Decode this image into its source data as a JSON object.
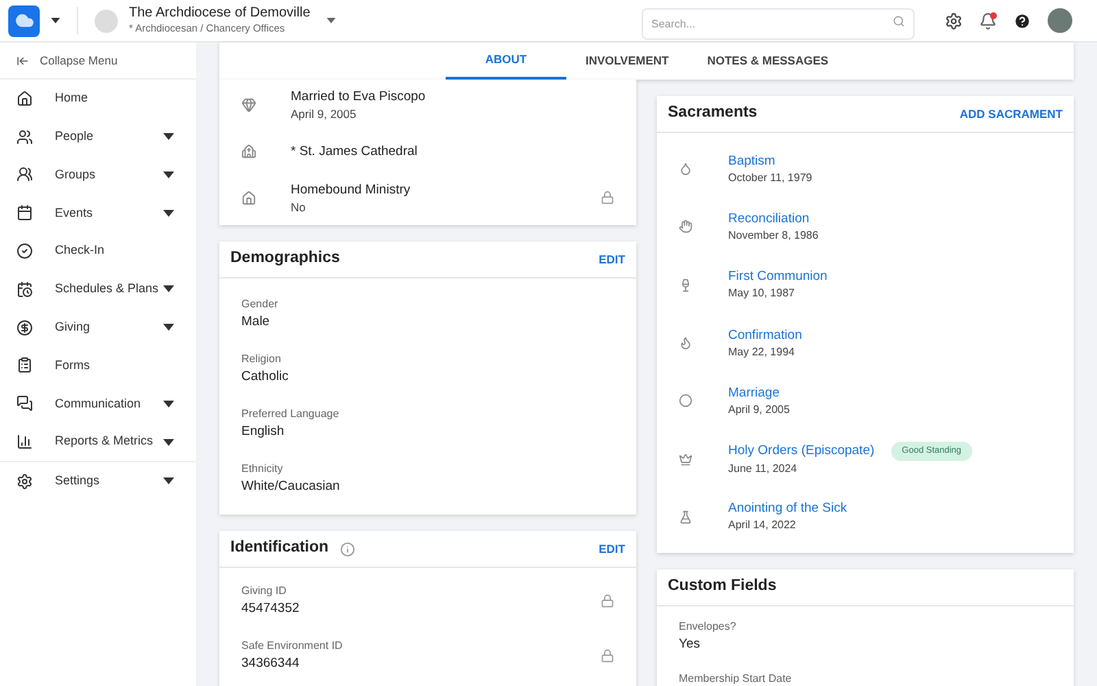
{
  "header": {
    "org_name": "The Archdiocese of Demoville",
    "org_subtitle": "* Archdiocesan / Chancery Offices",
    "search": {
      "placeholder": "Search..."
    },
    "has_notification": true
  },
  "sidebar": {
    "collapse_label": "Collapse Menu",
    "items": [
      {
        "label": "Home",
        "expandable": false
      },
      {
        "label": "People",
        "expandable": true
      },
      {
        "label": "Groups",
        "expandable": true
      },
      {
        "label": "Events",
        "expandable": true
      },
      {
        "label": "Check-In",
        "expandable": false
      },
      {
        "label": "Schedules & Plans",
        "expandable": true
      },
      {
        "label": "Giving",
        "expandable": true
      },
      {
        "label": "Forms",
        "expandable": false
      },
      {
        "label": "Communication",
        "expandable": true
      },
      {
        "label": "Reports & Metrics",
        "expandable": true
      }
    ],
    "footer_items": [
      {
        "label": "Settings",
        "expandable": true
      }
    ]
  },
  "tabs": [
    {
      "label": "ABOUT",
      "selected": true
    },
    {
      "label": "INVOLVEMENT",
      "selected": false
    },
    {
      "label": "NOTES & MESSAGES",
      "selected": false
    }
  ],
  "about_items": [
    {
      "title": "Married to Eva Piscopo",
      "detail": "April 9, 2005",
      "locked": false
    },
    {
      "title": "* St. James Cathedral",
      "locked": false
    },
    {
      "title": "Homebound Ministry",
      "detail": "No",
      "locked": true
    }
  ],
  "demographics": {
    "title": "Demographics",
    "action": "EDIT",
    "fields": [
      {
        "label": "Gender",
        "value": "Male"
      },
      {
        "label": "Religion",
        "value": "Catholic"
      },
      {
        "label": "Preferred Language",
        "value": "English"
      },
      {
        "label": "Ethnicity",
        "value": "White/Caucasian"
      }
    ]
  },
  "identification": {
    "title": "Identification",
    "action": "EDIT",
    "fields": [
      {
        "label": "Giving ID",
        "value": "45474352",
        "locked": true
      },
      {
        "label": "Safe Environment ID",
        "value": "34366344",
        "locked": true
      }
    ]
  },
  "sacraments": {
    "title": "Sacraments",
    "action": "ADD SACRAMENT",
    "items": [
      {
        "name": "Baptism",
        "date": "October 11, 1979"
      },
      {
        "name": "Reconciliation",
        "date": "November 8, 1986"
      },
      {
        "name": "First Communion",
        "date": "May 10, 1987"
      },
      {
        "name": "Confirmation",
        "date": "May 22, 1994"
      },
      {
        "name": "Marriage",
        "date": "April 9, 2005"
      },
      {
        "name": "Holy Orders (Episcopate)",
        "date": "June 11, 2024",
        "badge": "Good Standing"
      },
      {
        "name": "Anointing of the Sick",
        "date": "April 14, 2022"
      }
    ]
  },
  "custom_fields": {
    "title": "Custom Fields",
    "fields": [
      {
        "label": "Envelopes?",
        "value": "Yes"
      },
      {
        "label": "Membership Start Date"
      }
    ]
  }
}
